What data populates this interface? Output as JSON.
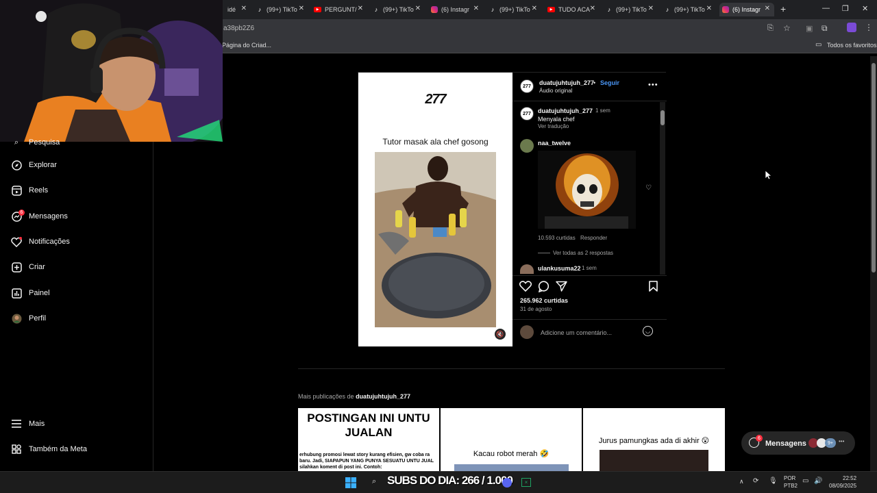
{
  "browser": {
    "tabs": [
      {
        "label": "idé",
        "icon": "tiktok-icon",
        "kind": "tiktok"
      },
      {
        "label": "(99+) TikTo",
        "icon": "tiktok-icon",
        "kind": "tiktok"
      },
      {
        "label": "PERGUNT/",
        "icon": "youtube-icon",
        "kind": "yt"
      },
      {
        "label": "(99+) TikTo",
        "icon": "tiktok-icon",
        "kind": "tiktok"
      },
      {
        "label": "(6) Instagr",
        "icon": "instagram-icon",
        "kind": "ig"
      },
      {
        "label": "(99+) TikTo",
        "icon": "tiktok-icon",
        "kind": "tiktok"
      },
      {
        "label": "TUDO ACA",
        "icon": "youtube-icon",
        "kind": "yt"
      },
      {
        "label": "(99+) TikTo",
        "icon": "tiktok-icon",
        "kind": "tiktok"
      },
      {
        "label": "(99+) TikTo",
        "icon": "tiktok-icon",
        "kind": "tiktok"
      },
      {
        "label": "(6) Instagr",
        "icon": "instagram-icon",
        "kind": "ig",
        "active": true
      }
    ],
    "url_fragment": "a38pb2Z6",
    "bookmark": "Página do Criad...",
    "all_favorites": "Todos os favoritos"
  },
  "sidebar": {
    "search_partial": "Pesquisa",
    "items": [
      {
        "label": "Explorar",
        "icon": "compass-icon"
      },
      {
        "label": "Reels",
        "icon": "reels-icon"
      },
      {
        "label": "Mensagens",
        "icon": "messenger-icon",
        "badge": "6"
      },
      {
        "label": "Notificações",
        "icon": "heart-icon"
      },
      {
        "label": "Criar",
        "icon": "plus-square-icon"
      },
      {
        "label": "Painel",
        "icon": "chart-icon"
      },
      {
        "label": "Perfil",
        "icon": "avatar-icon"
      }
    ],
    "more": "Mais",
    "meta": "Também da Meta"
  },
  "post": {
    "logo": "277",
    "caption_title": "Tutor masak ala chef gosong",
    "author": "duatujuhtujuh_277",
    "follow": "Seguir",
    "audio": "Áudio original",
    "caption_author": "duatujuhtujuh_277",
    "caption_time": "1 sem",
    "caption_text": "Menyala chef",
    "see_translation": "Ver tradução",
    "comment1": {
      "user": "naa_twelve",
      "likes": "10.593 curtidas",
      "reply": "Responder",
      "view_replies": "Ver todas as 2 respostas"
    },
    "comment2": {
      "user": "ulankusuma22",
      "time": "1 sem"
    },
    "likes": "265.962 curtidas",
    "date": "31 de agosto",
    "comment_placeholder": "Adicione um comentário..."
  },
  "more_posts": {
    "heading_prefix": "Mais publicações de",
    "heading_user": "duatujuhtujuh_277",
    "cells": [
      {
        "title": "POSTINGAN INI UNTU JUALAN",
        "text": "erhubung promosi lewat story kurang efisien, gw coba ra baru. Jadi, SIAPAPUN YANG PUNYA SESUATU UNTU JUAL silahkan koment di post ini. Contoh:"
      },
      {
        "title": "Kacau robot merah 🤣"
      },
      {
        "title": "Jurus pamungkas ada di akhir 😲"
      }
    ]
  },
  "messages_pill": {
    "label": "Mensagens",
    "badge": "6",
    "count": "9+"
  },
  "taskbar": {
    "overlay_text": "SUBS DO DIA: 266 / 1.000",
    "lang_top": "POR",
    "lang_bottom": "PTB2",
    "time": "22:52",
    "date": "08/09/2025"
  }
}
